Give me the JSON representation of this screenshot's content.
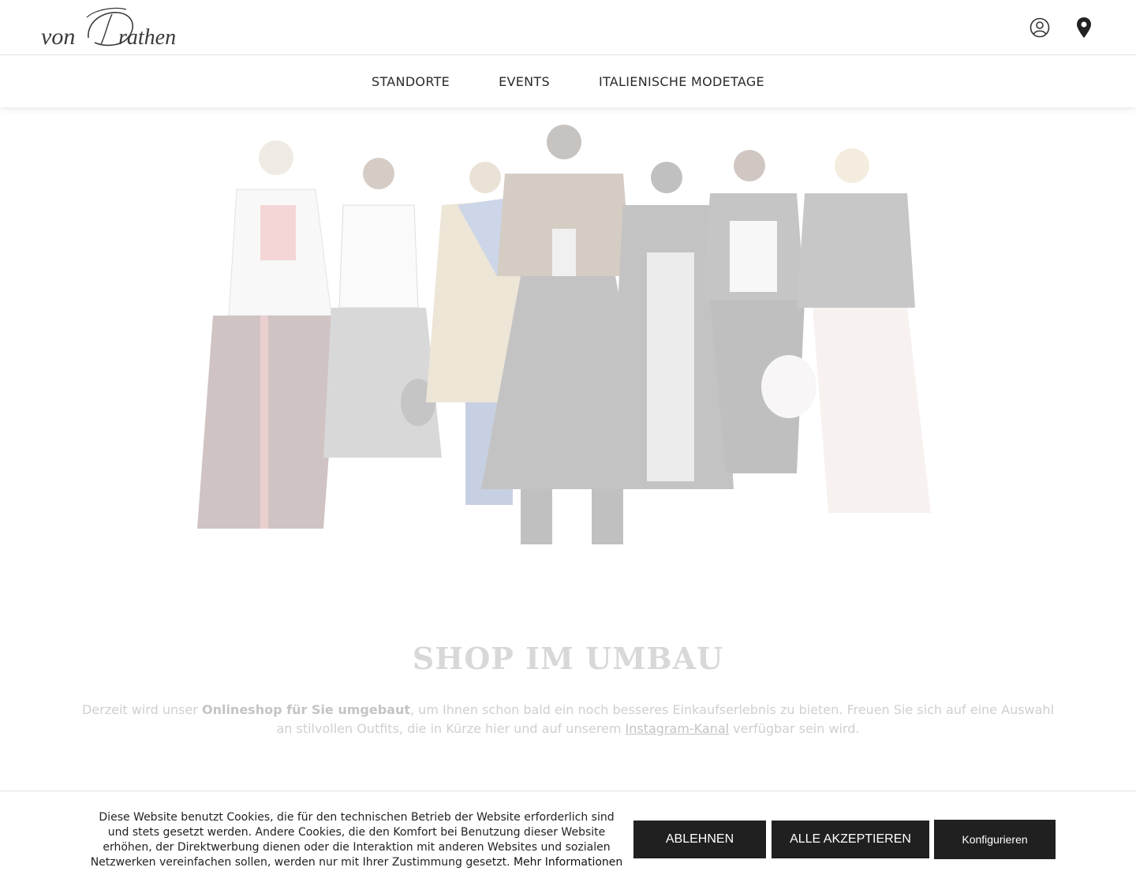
{
  "header": {
    "logo_alt": "von Drathen",
    "icons": [
      "account-icon",
      "location-pin-icon"
    ]
  },
  "nav": {
    "items": [
      {
        "label": "STANDORTE"
      },
      {
        "label": "EVENTS"
      },
      {
        "label": "ITALIENISCHE MODETAGE"
      }
    ]
  },
  "main": {
    "title": "SHOP IM UMBAU",
    "text_part1": "Derzeit wird unser ",
    "text_bold": "Onlineshop für Sie umgebaut",
    "text_part2": ", um Ihnen schon bald ein noch besseres Einkaufserlebnis zu bieten. Freuen Sie sich auf eine Auswahl an stilvollen Outfits, die in Kürze hier und auf unserem ",
    "text_link": "Instagram-Kanal",
    "text_part3": " verfügbar sein wird."
  },
  "cookie": {
    "text": "Diese Website benutzt Cookies, die für den technischen Betrieb der Website erforderlich sind und stets gesetzt werden. Andere Cookies, die den Komfort bei Benutzung dieser Website erhöhen, der Direktwerbung dienen oder die Interaktion mit anderen Websites und sozialen Netzwerken vereinfachen sollen, werden nur mit Ihrer Zustimmung gesetzt. ",
    "more_link": "Mehr Informationen",
    "decline_label": "ABLEHNEN",
    "accept_label": "ALLE AKZEPTIEREN",
    "configure_label": "Konfigurieren"
  }
}
